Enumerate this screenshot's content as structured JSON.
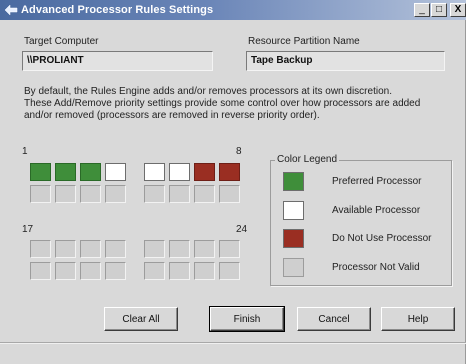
{
  "window": {
    "title": "Advanced Processor Rules Settings",
    "controls": {
      "minimize": "_",
      "maximize": "□",
      "close": "X"
    }
  },
  "target_computer": {
    "label": "Target Computer",
    "value": "\\\\PROLIANT"
  },
  "resource_partition": {
    "label": "Resource Partition Name",
    "value": "Tape Backup"
  },
  "description": [
    "By default, the Rules Engine adds and/or removes processors at its own discretion.",
    "These Add/Remove priority settings provide some control over how processors are added",
    "and/or removed (processors are removed in reverse priority order)."
  ],
  "grid_labels": {
    "top_left": "1",
    "top_right": "8",
    "bottom_left": "17",
    "bottom_right": "24"
  },
  "colors": {
    "preferred": "#3f8e3a",
    "available": "#ffffff",
    "do_not_use": "#9a2e22",
    "not_valid": "#cfcfcf"
  },
  "processors": [
    "preferred",
    "preferred",
    "preferred",
    "available",
    "available",
    "available",
    "donotuse",
    "donotuse",
    "notvalid",
    "notvalid",
    "notvalid",
    "notvalid",
    "notvalid",
    "notvalid",
    "notvalid",
    "notvalid",
    "notvalid",
    "notvalid",
    "notvalid",
    "notvalid",
    "notvalid",
    "notvalid",
    "notvalid",
    "notvalid",
    "notvalid",
    "notvalid",
    "notvalid",
    "notvalid",
    "notvalid",
    "notvalid",
    "notvalid",
    "notvalid"
  ],
  "legend": {
    "title": "Color Legend",
    "items": [
      {
        "label": "Preferred Processor",
        "state": "preferred"
      },
      {
        "label": "Available Processor",
        "state": "available"
      },
      {
        "label": "Do Not Use Processor",
        "state": "do_not_use"
      },
      {
        "label": "Processor Not Valid",
        "state": "not_valid"
      }
    ]
  },
  "buttons": {
    "clear_all": "Clear All",
    "finish": "Finish",
    "cancel": "Cancel",
    "help": "Help"
  }
}
